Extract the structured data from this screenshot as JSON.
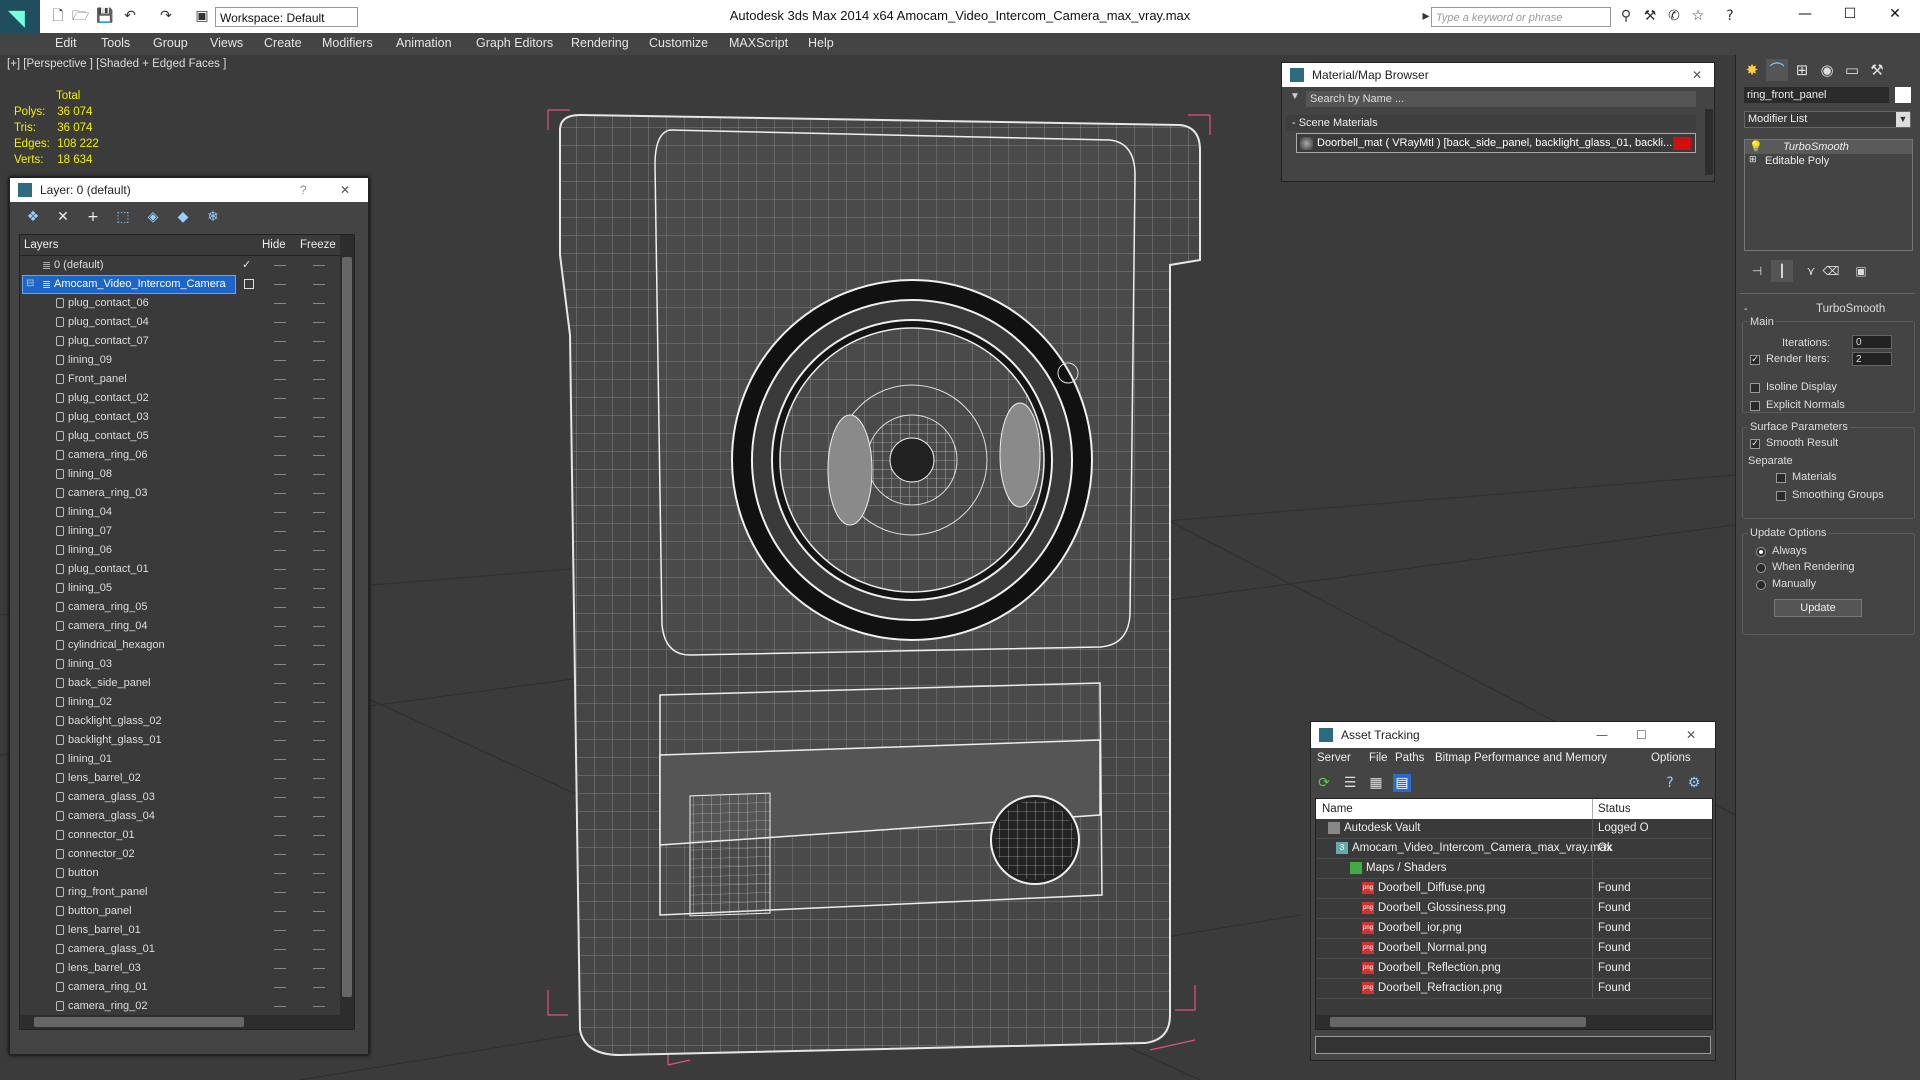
{
  "window": {
    "title": "Autodesk 3ds Max  2014 x64       Amocam_Video_Intercom_Camera_max_vray.max",
    "workspace": "Workspace: Default",
    "search_placeholder": "Type a keyword or phrase"
  },
  "menu": [
    "Edit",
    "Tools",
    "Group",
    "Views",
    "Create",
    "Modifiers",
    "Animation",
    "Graph Editors",
    "Rendering",
    "Customize",
    "MAXScript",
    "Help"
  ],
  "viewport": {
    "label": "[+] [Perspective ] [Shaded + Edged Faces ]",
    "stats": {
      "header": "Total",
      "rows": [
        {
          "label": "Polys:",
          "value": "36 074"
        },
        {
          "label": "Tris:",
          "value": "36 074"
        },
        {
          "label": "Edges:",
          "value": "108 222"
        },
        {
          "label": "Verts:",
          "value": "18 634"
        }
      ]
    }
  },
  "layer_panel": {
    "title": "Layer: 0 (default)",
    "help": "?",
    "columns": {
      "layers": "Layers",
      "hide": "Hide",
      "freeze": "Freeze"
    },
    "root_layer": "0 (default)",
    "selected_layer": "Amocam_Video_Intercom_Camera",
    "objects": [
      "plug_contact_06",
      "plug_contact_04",
      "plug_contact_07",
      "lining_09",
      "Front_panel",
      "plug_contact_02",
      "plug_contact_03",
      "plug_contact_05",
      "camera_ring_06",
      "lining_08",
      "camera_ring_03",
      "lining_04",
      "lining_07",
      "lining_06",
      "plug_contact_01",
      "lining_05",
      "camera_ring_05",
      "camera_ring_04",
      "cylindrical_hexagon",
      "lining_03",
      "back_side_panel",
      "lining_02",
      "backlight_glass_02",
      "backlight_glass_01",
      "lining_01",
      "lens_barrel_02",
      "camera_glass_03",
      "camera_glass_04",
      "connector_01",
      "connector_02",
      "button",
      "ring_front_panel",
      "button_panel",
      "lens_barrel_01",
      "camera_glass_01",
      "lens_barrel_03",
      "camera_ring_01",
      "camera_ring_02",
      "Amocam_Video_Intercom_Camera"
    ]
  },
  "material_browser": {
    "title": "Material/Map Browser",
    "search_placeholder": "Search by Name ...",
    "section": "- Scene Materials",
    "material": "Doorbell_mat ( VRayMtl ) [back_side_panel, backlight_glass_01, backli..."
  },
  "asset_tracking": {
    "title": "Asset Tracking",
    "menu": [
      "Server",
      "File",
      "Paths",
      "Bitmap Performance and Memory",
      "Options"
    ],
    "columns": {
      "name": "Name",
      "status": "Status"
    },
    "rows": [
      {
        "name": "Autodesk Vault",
        "status": "Logged O",
        "indent": 0
      },
      {
        "name": "Amocam_Video_Intercom_Camera_max_vray.max",
        "status": "Ok",
        "indent": 1
      },
      {
        "name": "Maps / Shaders",
        "status": "",
        "indent": 2
      },
      {
        "name": "Doorbell_Diffuse.png",
        "status": "Found",
        "indent": 3
      },
      {
        "name": "Doorbell_Glossiness.png",
        "status": "Found",
        "indent": 3
      },
      {
        "name": "Doorbell_ior.png",
        "status": "Found",
        "indent": 3
      },
      {
        "name": "Doorbell_Normal.png",
        "status": "Found",
        "indent": 3
      },
      {
        "name": "Doorbell_Reflection.png",
        "status": "Found",
        "indent": 3
      },
      {
        "name": "Doorbell_Refraction.png",
        "status": "Found",
        "indent": 3
      }
    ]
  },
  "command_panel": {
    "object_name": "ring_front_panel",
    "modifier_list": "Modifier List",
    "stack": [
      "TurboSmooth",
      "Editable Poly"
    ],
    "rollout_title": "TurboSmooth",
    "main_label": "Main",
    "iterations_label": "Iterations:",
    "iterations_value": "0",
    "render_iters_label": "Render Iters:",
    "render_iters_value": "2",
    "isoline": "Isoline Display",
    "explicit": "Explicit Normals",
    "surface_params": "Surface Parameters",
    "smooth_result": "Smooth Result",
    "separate": "Separate",
    "materials": "Materials",
    "smoothing_groups": "Smoothing Groups",
    "update_options": "Update Options",
    "always": "Always",
    "when_rendering": "When Rendering",
    "manually": "Manually",
    "update": "Update"
  }
}
